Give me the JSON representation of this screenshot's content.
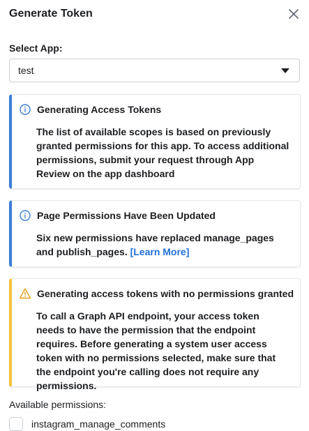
{
  "dialog": {
    "title": "Generate Token",
    "close_icon": "close-icon"
  },
  "select_app": {
    "label": "Select App:",
    "value": "test",
    "icon": "chevron-down-icon"
  },
  "notices": [
    {
      "type": "info",
      "icon": "info-icon",
      "color": "#3b7dd8",
      "title": "Generating Access Tokens",
      "body": "The list of available scopes is based on previously granted permissions for this app. To access additional permissions, submit your request through App Review on the app dashboard"
    },
    {
      "type": "info",
      "icon": "info-icon",
      "color": "#3b7dd8",
      "title": "Page Permissions Have Been Updated",
      "body": "Six new permissions have replaced manage_pages and publish_pages.",
      "link": "[Learn More]"
    },
    {
      "type": "warning",
      "icon": "warning-icon",
      "color": "#f5c33b",
      "title": "Generating access tokens with no permissions granted",
      "body": "To call a Graph API endpoint, your access token needs to have the permission that the endpoint requires. Before generating a system user access token with no permissions selected, make sure that the endpoint you're calling does not require any permissions."
    }
  ],
  "permissions": {
    "label": "Available permissions:",
    "items": [
      {
        "name": "instagram_manage_comments",
        "checked": false
      }
    ]
  }
}
